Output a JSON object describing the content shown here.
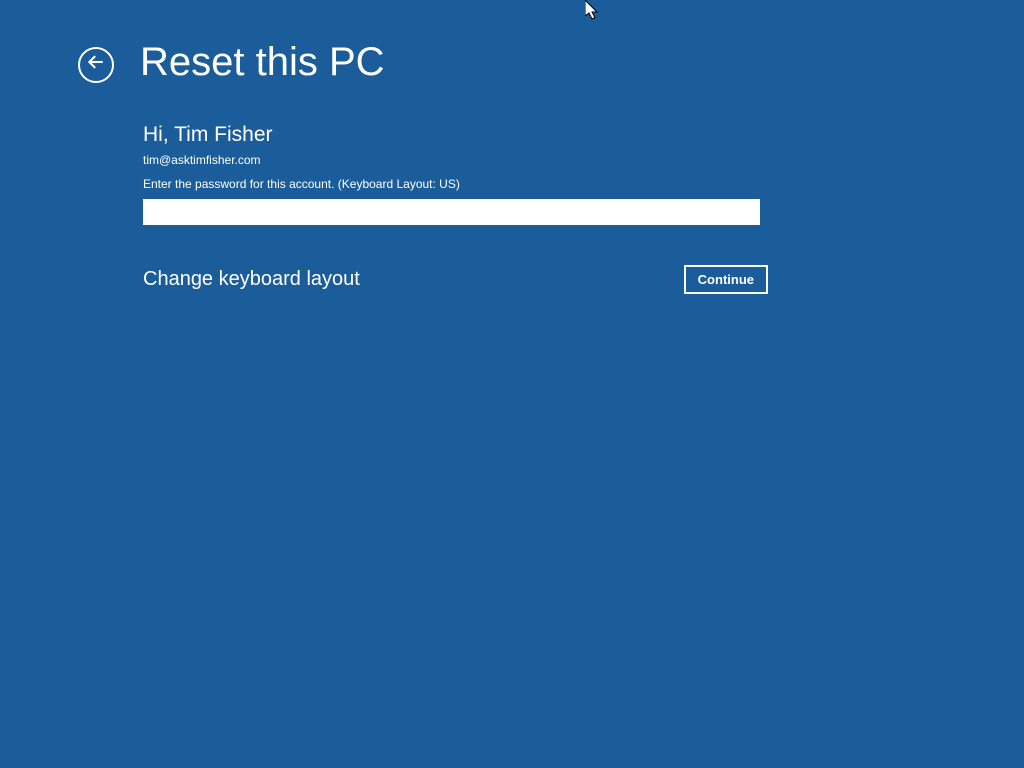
{
  "header": {
    "title": "Reset this PC"
  },
  "account": {
    "greeting": "Hi, Tim Fisher",
    "email": "tim@asktimfisher.com",
    "instruction": "Enter the password for this account. (Keyboard Layout: US)",
    "password_value": ""
  },
  "actions": {
    "keyboard_link": "Change keyboard layout",
    "continue_label": "Continue"
  }
}
